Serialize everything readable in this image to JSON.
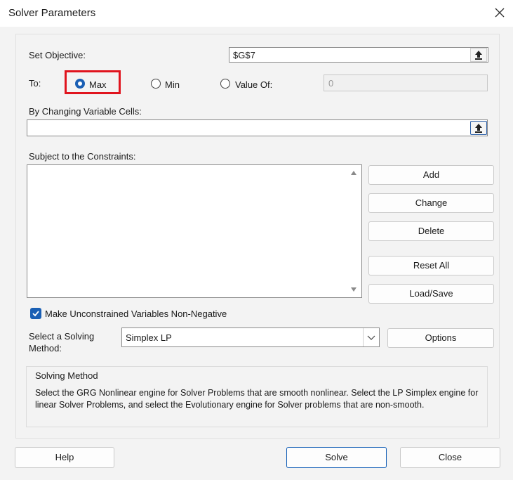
{
  "window": {
    "title": "Solver Parameters"
  },
  "objective": {
    "label": "Set Objective:",
    "value": "$G$7"
  },
  "to": {
    "label": "To:",
    "options": [
      {
        "label": "Max",
        "selected": true
      },
      {
        "label": "Min",
        "selected": false
      },
      {
        "label": "Value Of:",
        "selected": false
      }
    ],
    "value_of": "0"
  },
  "variables": {
    "label": "By Changing Variable Cells:",
    "value": ""
  },
  "constraints": {
    "label": "Subject to the Constraints:",
    "buttons": {
      "add": "Add",
      "change": "Change",
      "delete": "Delete",
      "reset_all": "Reset All",
      "load_save": "Load/Save"
    }
  },
  "nonneg": {
    "label": "Make Unconstrained Variables Non-Negative",
    "checked": true
  },
  "method": {
    "label_line1": "Select a Solving",
    "label_line2": "Method:",
    "selected": "Simplex LP",
    "options_button": "Options",
    "box_title": "Solving Method",
    "description": "Select the GRG Nonlinear engine for Solver Problems that are smooth nonlinear. Select the LP Simplex engine for linear Solver Problems, and select the Evolutionary engine for Solver problems that are non-smooth."
  },
  "footer": {
    "help": "Help",
    "solve": "Solve",
    "close": "Close"
  },
  "colors": {
    "accent": "#1a5fb4",
    "highlight": "#e0141e",
    "background": "#f3f3f3"
  }
}
